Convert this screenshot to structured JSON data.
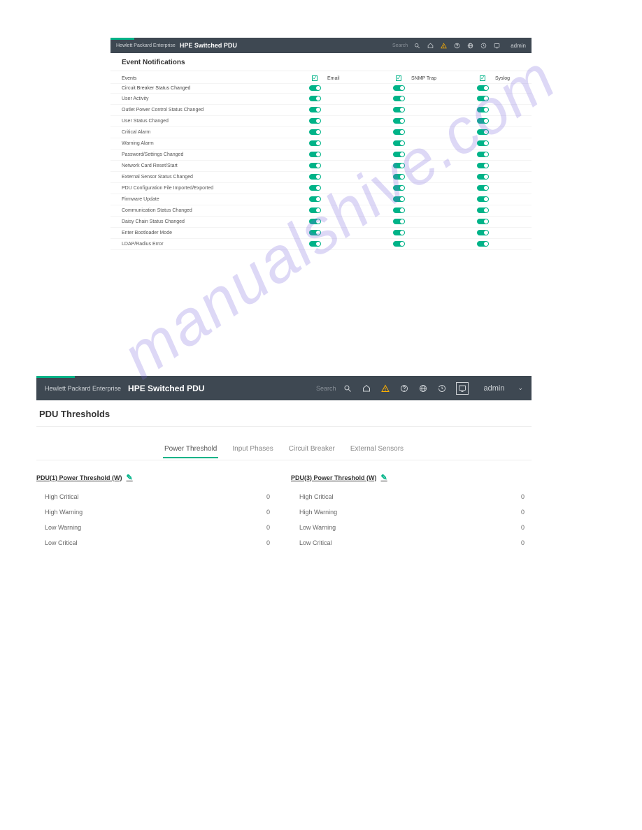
{
  "watermark": "manualshive.com",
  "s1": {
    "brand": "Hewlett Packard\nEnterprise",
    "title": "HPE Switched PDU",
    "search": "Search",
    "user": "admin",
    "page_title": "Event Notifications",
    "cols": {
      "events": "Events",
      "email": "Email",
      "snmp": "SNMP Trap",
      "syslog": "Syslog"
    },
    "events": [
      "Circuit Breaker Status Changed",
      "User Activity",
      "Outlet Power Control Status Changed",
      "User Status Changed",
      "Critical Alarm",
      "Warning Alarm",
      "Password/Settings Changed",
      "Network Card Reset/Start",
      "External Sensor Status Changed",
      "PDU Configuration File Imported/Exported",
      "Firmware Update",
      "Communication Status Changed",
      "Daisy Chain Status Changed",
      "Enter Bootloader Mode",
      "LDAP/Radius Error"
    ]
  },
  "s2": {
    "brand": "Hewlett Packard\nEnterprise",
    "title": "HPE Switched PDU",
    "search": "Search",
    "user": "admin",
    "page_title": "PDU Thresholds",
    "tabs": [
      "Power Threshold",
      "Input Phases",
      "Circuit Breaker",
      "External Sensors"
    ],
    "tab_active": 0,
    "pdu1": {
      "title": "PDU(1) Power Threshold (W)",
      "rows": [
        [
          "High Critical",
          "0"
        ],
        [
          "High Warning",
          "0"
        ],
        [
          "Low Warning",
          "0"
        ],
        [
          "Low Critical",
          "0"
        ]
      ]
    },
    "pdu3": {
      "title": "PDU(3) Power Threshold (W)",
      "rows": [
        [
          "High Critical",
          "0"
        ],
        [
          "High Warning",
          "0"
        ],
        [
          "Low Warning",
          "0"
        ],
        [
          "Low Critical",
          "0"
        ]
      ]
    }
  }
}
